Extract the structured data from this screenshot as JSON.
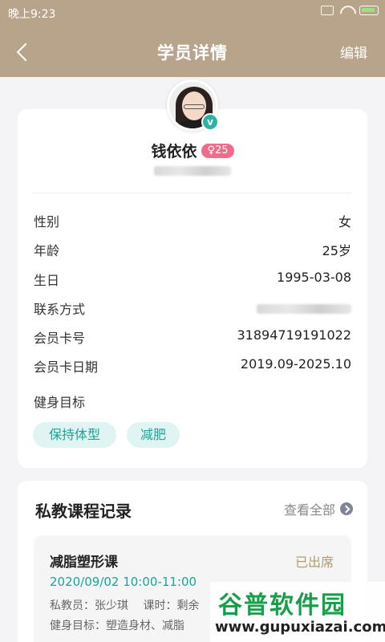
{
  "status_bar": {
    "time": "晚上9:23"
  },
  "nav": {
    "title": "学员详情",
    "edit_label": "编辑"
  },
  "profile": {
    "name": "钱依依",
    "gender_age_badge": "♀25",
    "verified_badge": "v",
    "fields": [
      {
        "label": "性别",
        "value": "女"
      },
      {
        "label": "年龄",
        "value": "25岁"
      },
      {
        "label": "生日",
        "value": "1995-03-08"
      },
      {
        "label": "联系方式",
        "value": ""
      },
      {
        "label": "会员卡号",
        "value": "31894719191022"
      },
      {
        "label": "会员卡日期",
        "value": "2019.09-2025.10"
      }
    ],
    "goals_title": "健身目标",
    "goal_tags": [
      "保持体型",
      "减肥"
    ]
  },
  "courses": {
    "title": "私教课程记录",
    "see_all_label": "查看全部",
    "records": [
      {
        "name": "减脂塑形课",
        "status": "已出席",
        "time": "2020/09/02 10:00-11:00",
        "trainer_line": "私教员：张少琪　 课时：剩余",
        "goal_line": "健身目标：塑造身材、减脂"
      }
    ]
  },
  "watermark": {
    "logo": "谷普软件园",
    "url": "www.gupuxiazai.com"
  },
  "colors": {
    "header": "#b8a48a",
    "accent": "#1aa49a",
    "tag_bg": "#dff4f3",
    "badge_pink": "#f26b8a",
    "status_gold": "#b59a6d"
  }
}
